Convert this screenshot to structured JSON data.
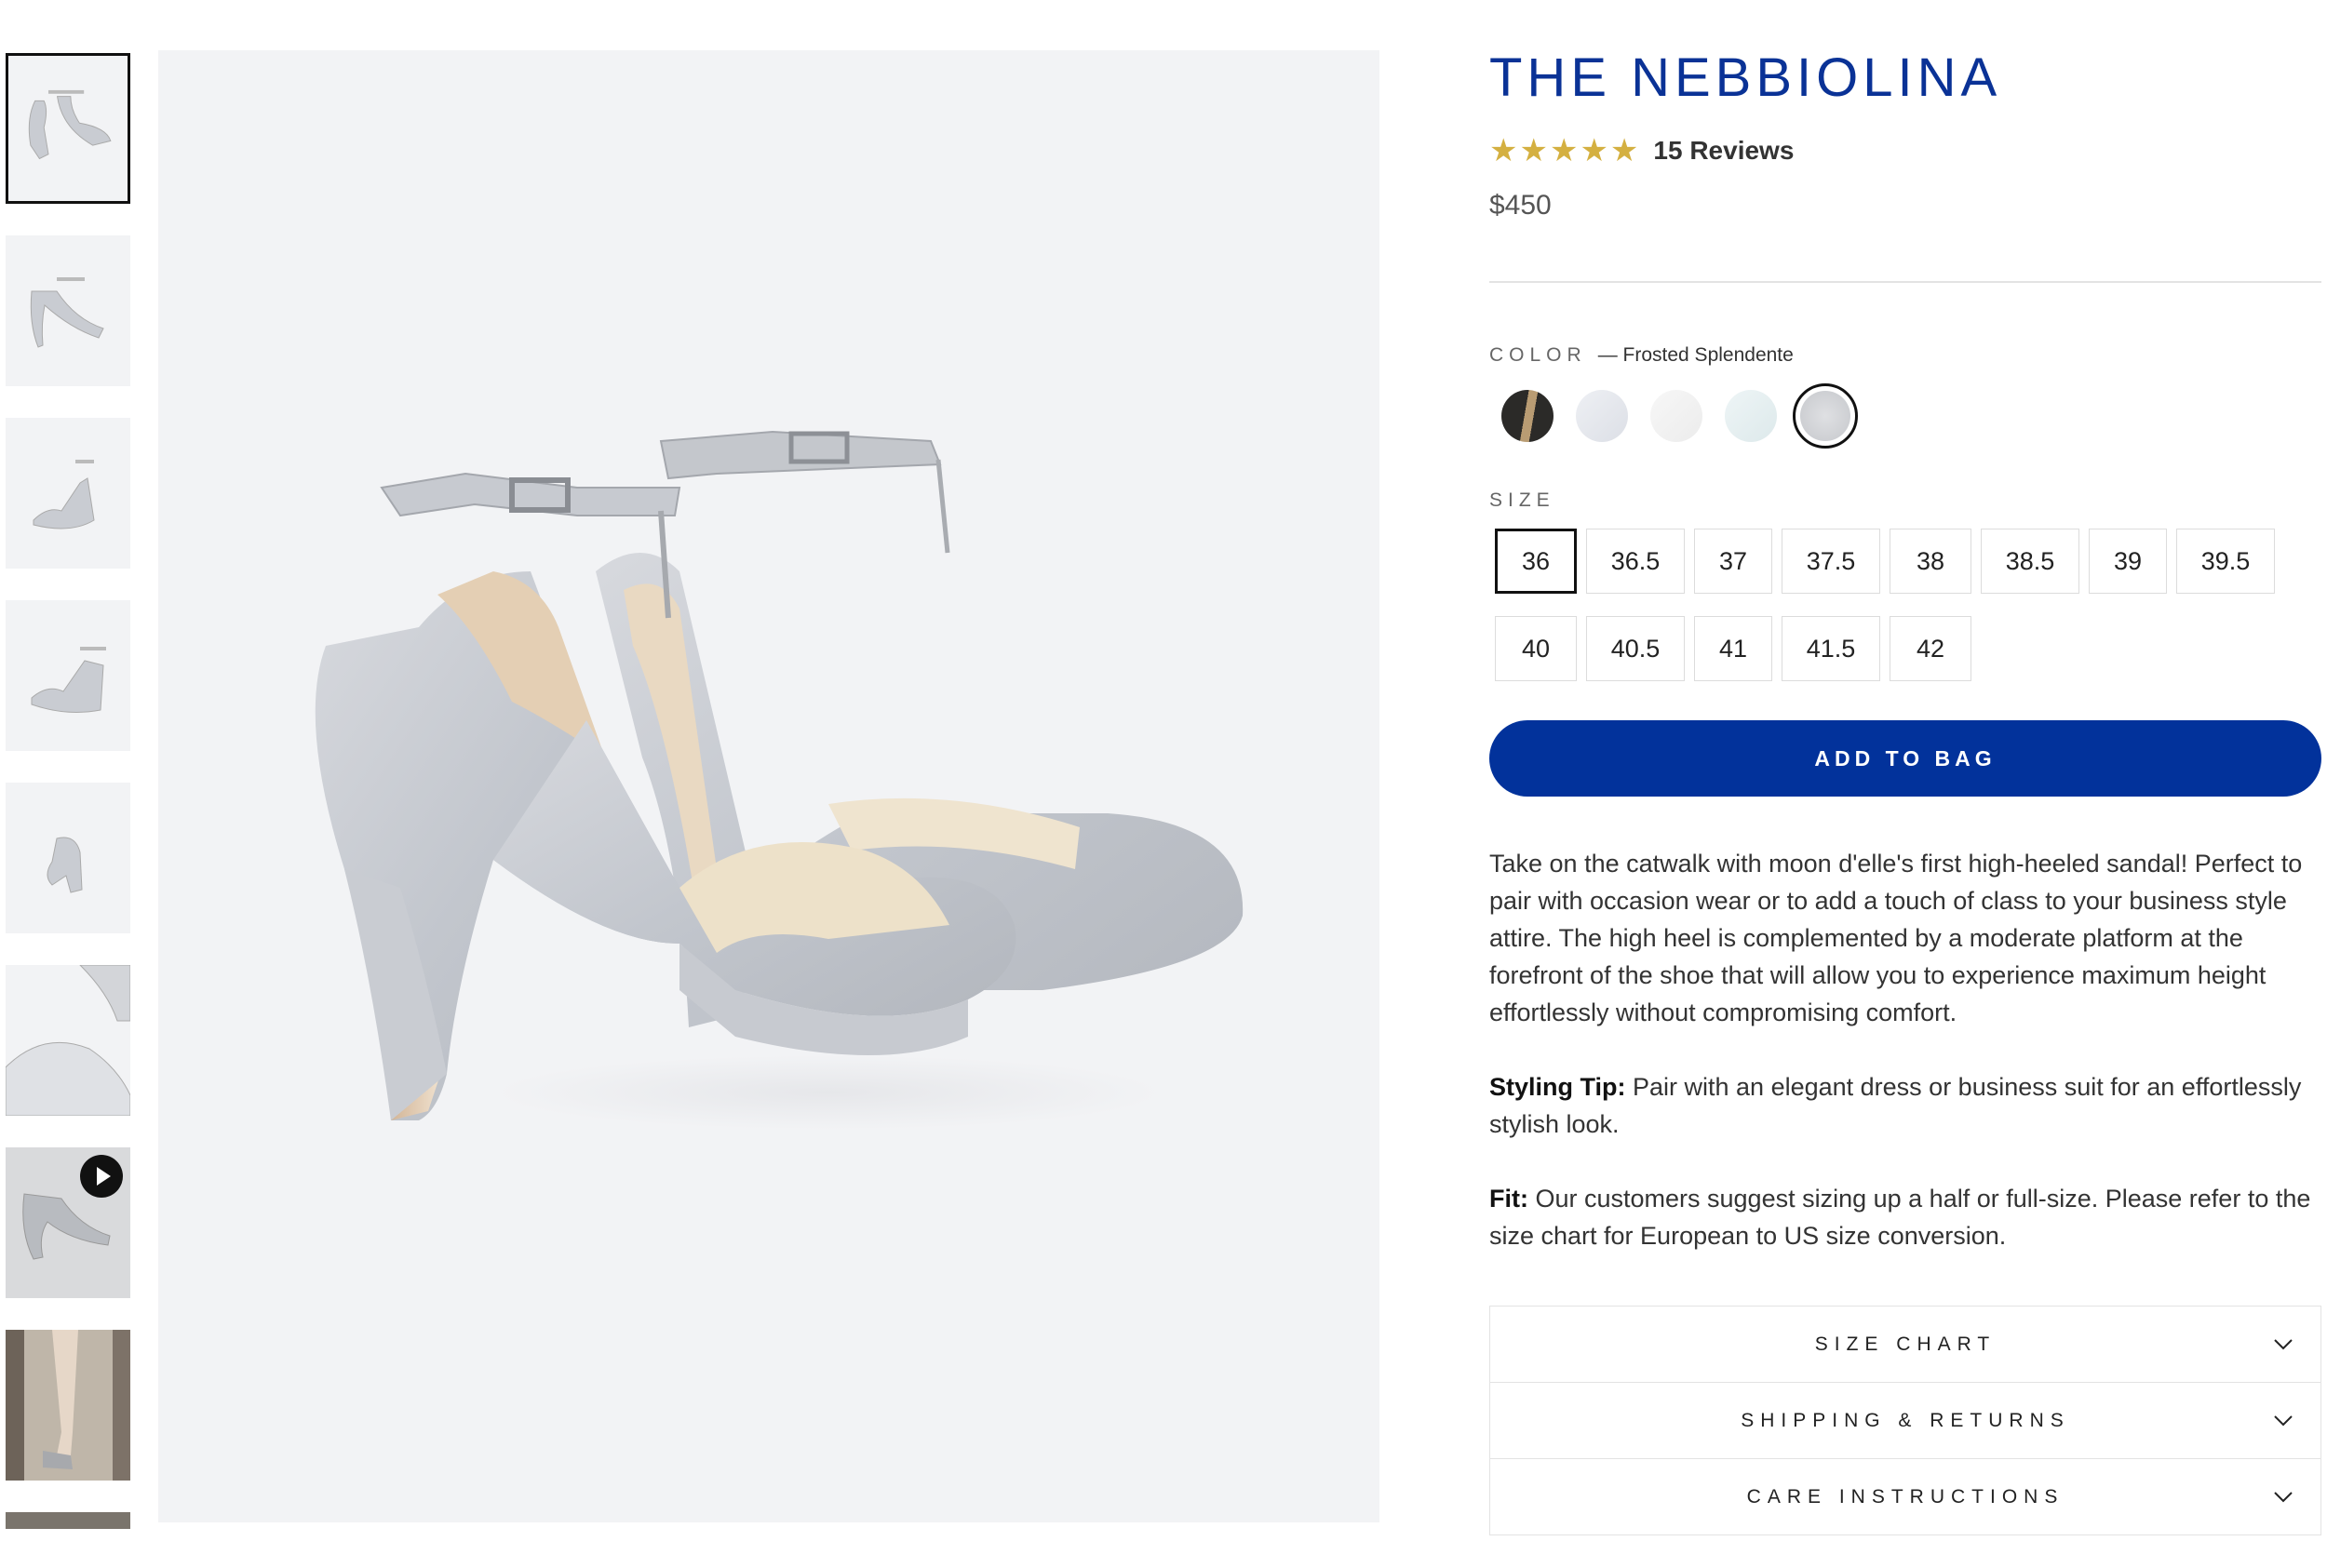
{
  "product": {
    "title": "THE NEBBIOLINA",
    "stars": "★★★★★",
    "reviews": "15 Reviews",
    "price": "$450"
  },
  "color": {
    "label": "COLOR",
    "selected_name": "Frosted Splendente",
    "swatches": [
      {
        "name": "black-gold",
        "color": "#2b2a28",
        "accent": "#b99c73"
      },
      {
        "name": "silver-light",
        "color": "#e7e9ee"
      },
      {
        "name": "pearl-white",
        "color": "#f2f2f2"
      },
      {
        "name": "ice-blue",
        "color": "#e6f0f1"
      },
      {
        "name": "frosted-splendente",
        "color": "#d6d7da",
        "selected": true
      }
    ]
  },
  "size": {
    "label": "SIZE",
    "options": [
      "36",
      "36.5",
      "37",
      "37.5",
      "38",
      "38.5",
      "39",
      "39.5",
      "40",
      "40.5",
      "41",
      "41.5",
      "42"
    ],
    "selected": "36"
  },
  "cta": {
    "add_to_bag": "ADD TO BAG"
  },
  "description": {
    "body": "Take on the catwalk with moon d'elle's first high-heeled sandal! Perfect to pair with occasion wear or to add a touch of class to your business style attire. The high heel is complemented by a moderate platform at the forefront of the shoe that will allow you to experience maximum height effortlessly without compromising comfort.",
    "styling_label": "Styling Tip:",
    "styling_text": " Pair with an elegant dress or business suit for an effortlessly stylish look.",
    "fit_label": "Fit:",
    "fit_text": " Our customers suggest sizing up a half or full-size. Please refer to the size chart for European to US size conversion."
  },
  "accordion": [
    "SIZE CHART",
    "SHIPPING & RETURNS",
    "CARE INSTRUCTIONS"
  ],
  "thumbnails": [
    {
      "name": "thumb-pair-front",
      "active": true
    },
    {
      "name": "thumb-single-side"
    },
    {
      "name": "thumb-single-angle"
    },
    {
      "name": "thumb-pair-side"
    },
    {
      "name": "thumb-back"
    },
    {
      "name": "thumb-top-closeup"
    },
    {
      "name": "thumb-video",
      "video": true
    },
    {
      "name": "thumb-model-stairs"
    },
    {
      "name": "thumb-more"
    }
  ],
  "colors": {
    "brand_blue": "#02329b",
    "title_blue": "#0a3296",
    "star_gold": "#d4b041"
  }
}
